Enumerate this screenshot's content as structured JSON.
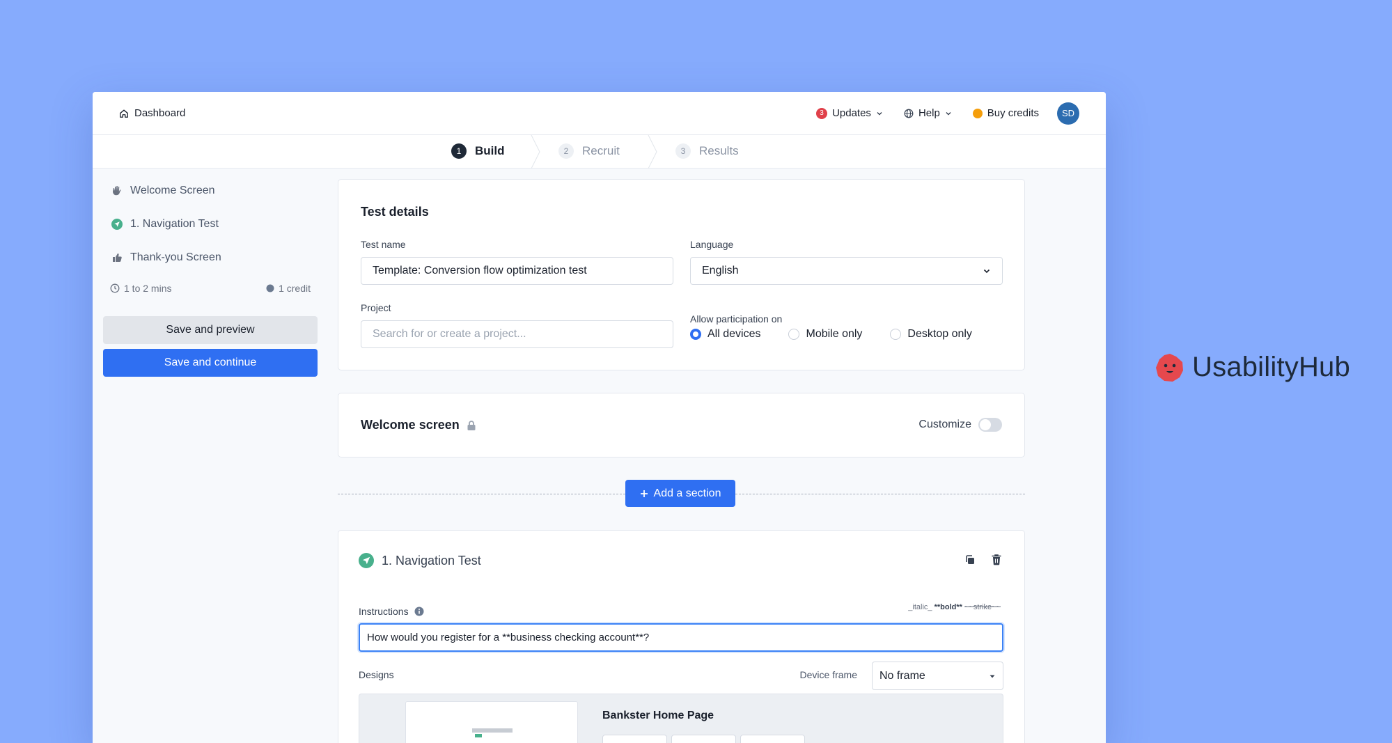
{
  "topbar": {
    "dashboard": "Dashboard",
    "updates_count": "3",
    "updates": "Updates",
    "help": "Help",
    "buy_credits": "Buy credits",
    "avatar_initials": "SD"
  },
  "steps": [
    {
      "num": "1",
      "label": "Build"
    },
    {
      "num": "2",
      "label": "Recruit"
    },
    {
      "num": "3",
      "label": "Results"
    }
  ],
  "sidebar": {
    "items": [
      {
        "label": "Welcome Screen",
        "icon": "wave-hand-icon"
      },
      {
        "label": "1. Navigation Test",
        "icon": "navigation-icon"
      },
      {
        "label": "Thank-you Screen",
        "icon": "thumbs-up-icon"
      }
    ],
    "duration": "1 to 2 mins",
    "credits": "1 credit",
    "save_preview": "Save and preview",
    "save_continue": "Save and continue"
  },
  "test_details": {
    "title": "Test details",
    "test_name_label": "Test name",
    "test_name_value": "Template: Conversion flow optimization test",
    "language_label": "Language",
    "language_value": "English",
    "project_label": "Project",
    "project_placeholder": "Search for or create a project...",
    "participation_label": "Allow participation on",
    "participation_options": [
      "All devices",
      "Mobile only",
      "Desktop only"
    ]
  },
  "welcome_card": {
    "title": "Welcome screen",
    "customize_label": "Customize"
  },
  "add_section": "Add a section",
  "nav_test": {
    "title": "1. Navigation Test",
    "instructions_label": "Instructions",
    "format_italic": "_italic_",
    "format_bold": "**bold**",
    "format_strike": "~~strike~~",
    "instructions_value": "How would you register for a **business checking account**?",
    "designs_label": "Designs",
    "device_frame_label": "Device frame",
    "device_frame_value": "No frame",
    "design_name": "Bankster Home Page"
  },
  "brand": {
    "name": "UsabilityHub"
  },
  "colors": {
    "background": "#86abfd",
    "accent": "#2f6ff2",
    "green": "#48b08c",
    "updates_badge": "#e0404a",
    "credits_dot": "#f59e0b"
  }
}
